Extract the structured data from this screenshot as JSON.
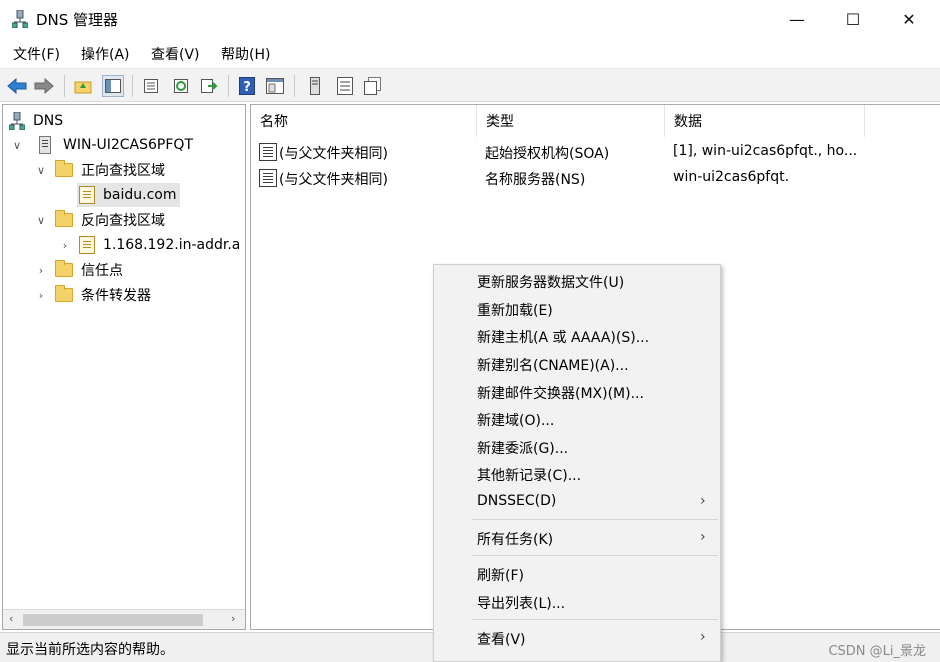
{
  "window": {
    "title": "DNS 管理器",
    "minimize": "—",
    "maximize": "☐",
    "close": "✕"
  },
  "menubar": {
    "items": [
      "文件(F)",
      "操作(A)",
      "查看(V)",
      "帮助(H)"
    ]
  },
  "toolbar": {
    "icons": [
      "back-icon",
      "forward-icon",
      "up-folder-icon",
      "show-hide-tree-icon",
      "properties-icon",
      "refresh-icon",
      "export-list-icon",
      "help-icon",
      "mmc-pane-icon",
      "server-icon",
      "list-icon",
      "copy-icon"
    ]
  },
  "tree": {
    "root": "DNS",
    "server": "WIN-UI2CAS6PFQT",
    "forward_zones": "正向查找区域",
    "forward_zone_item": "baidu.com",
    "reverse_zones": "反向查找区域",
    "reverse_zone_item": "1.168.192.in-addr.a",
    "trust_points": "信任点",
    "conditional_forwarders": "条件转发器"
  },
  "list": {
    "columns": [
      "名称",
      "类型",
      "数据"
    ],
    "rows": [
      {
        "name": "(与父文件夹相同)",
        "type": "起始授权机构(SOA)",
        "data": "[1], win-ui2cas6pfqt., ho..."
      },
      {
        "name": "(与父文件夹相同)",
        "type": "名称服务器(NS)",
        "data": "win-ui2cas6pfqt."
      }
    ]
  },
  "context_menu": {
    "items": [
      {
        "label": "更新服务器数据文件(U)",
        "submenu": false
      },
      {
        "label": "重新加载(E)",
        "submenu": false
      },
      {
        "label": "新建主机(A 或 AAAA)(S)...",
        "submenu": false
      },
      {
        "label": "新建别名(CNAME)(A)...",
        "submenu": false
      },
      {
        "label": "新建邮件交换器(MX)(M)...",
        "submenu": false
      },
      {
        "label": "新建域(O)...",
        "submenu": false
      },
      {
        "label": "新建委派(G)...",
        "submenu": false
      },
      {
        "label": "其他新记录(C)...",
        "submenu": false
      },
      {
        "label": "DNSSEC(D)",
        "submenu": true
      },
      {
        "label": "所有任务(K)",
        "submenu": true
      },
      {
        "label": "刷新(F)",
        "submenu": false
      },
      {
        "label": "导出列表(L)...",
        "submenu": false
      },
      {
        "label": "查看(V)",
        "submenu": true
      }
    ],
    "arrow": "›"
  },
  "statusbar": {
    "text": "显示当前所选内容的帮助。",
    "watermark": "CSDN @Li_景龙"
  }
}
